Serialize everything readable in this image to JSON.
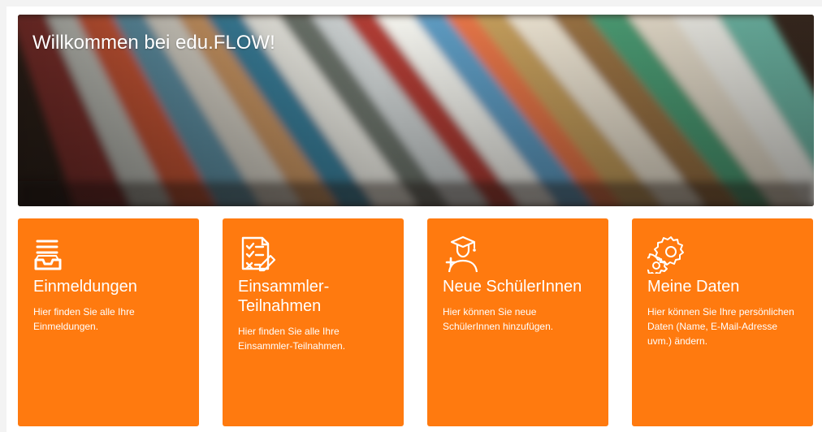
{
  "hero": {
    "title": "Willkommen bei edu.FLOW!"
  },
  "cards": [
    {
      "icon": "inbox-icon",
      "title": "Einmeldungen",
      "description": "Hier finden Sie alle Ihre Einmeldungen."
    },
    {
      "icon": "checklist-document-icon",
      "title": "Einsammler-Teilnahmen",
      "description": "Hier finden Sie alle Ihre Einsammler-Teilnahmen."
    },
    {
      "icon": "student-graduation-icon",
      "title": "Neue SchülerInnen",
      "description": "Hier können Sie neue SchülerInnen hinzufügen."
    },
    {
      "icon": "gears-icon",
      "title": "Meine Daten",
      "description": "Hier können Sie Ihre persönlichen Daten (Name, E-Mail-Adresse uvm.) ändern."
    }
  ],
  "colors": {
    "card_background": "#ff7a0f",
    "text": "#ffffff",
    "page_background": "#f3f3f3"
  }
}
